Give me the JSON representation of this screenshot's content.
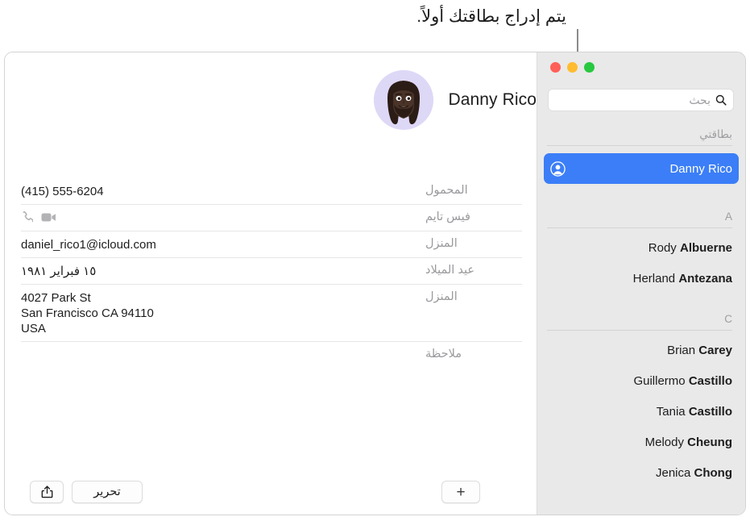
{
  "callout": {
    "text": "يتم إدراج بطاقتك أولاً."
  },
  "window": {
    "traffic_lights": [
      {
        "name": "minimize-or-zoom-green",
        "color": "#28c840"
      },
      {
        "name": "minimize-yellow",
        "color": "#febc2e"
      },
      {
        "name": "close-red",
        "color": "#ff5f57"
      }
    ]
  },
  "sidebar": {
    "search": {
      "placeholder": "بحث",
      "value": "",
      "icon": "search-icon"
    },
    "my_card_header": "بطاقتي",
    "selected_contact": {
      "name": "Danny Rico",
      "icon": "person-circle-icon",
      "highlight_color": "#3b7ef7"
    },
    "groups": [
      {
        "letter": "A",
        "contacts": [
          {
            "first": "Rody",
            "last": "Albuerne"
          },
          {
            "first": "Herland",
            "last": "Antezana"
          }
        ]
      },
      {
        "letter": "C",
        "contacts": [
          {
            "first": "Brian",
            "last": "Carey"
          },
          {
            "first": "Guillermo",
            "last": "Castillo"
          },
          {
            "first": "Tania",
            "last": "Castillo"
          },
          {
            "first": "Melody",
            "last": "Cheung"
          },
          {
            "first": "Jenica",
            "last": "Chong"
          }
        ]
      }
    ]
  },
  "card": {
    "name": "Danny Rico",
    "avatar": {
      "name": "memoji-avatar",
      "background_color": "#ded8f7"
    },
    "fields": [
      {
        "label": "المحمول",
        "value": "(415) 555-6204",
        "type": "phone"
      },
      {
        "label": "فيس تايم",
        "value": "",
        "type": "facetime",
        "icons": [
          "video-camera-icon",
          "phone-handset-icon"
        ]
      },
      {
        "label": "المنزل",
        "value": "daniel_rico1@icloud.com",
        "type": "email"
      },
      {
        "label": "عيد الميلاد",
        "value": "١٥ فبراير ١٩٨١",
        "type": "birthday"
      },
      {
        "label": "المنزل",
        "type": "address",
        "address_lines": [
          "4027 Park St",
          "San Francisco CA 94110",
          "USA"
        ]
      },
      {
        "label": "ملاحظة",
        "value": "",
        "type": "note"
      }
    ]
  },
  "toolbar": {
    "share_label": "",
    "share_icon": "share-icon",
    "edit_label": "تحرير",
    "add_label": "+",
    "add_icon": "plus-icon"
  }
}
